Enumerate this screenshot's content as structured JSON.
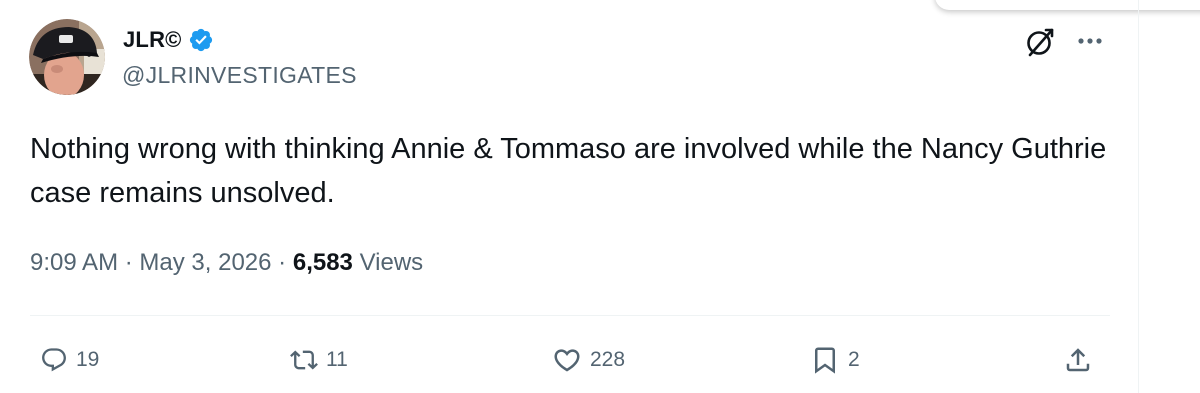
{
  "tweet": {
    "author": {
      "display_name": "JLR©",
      "handle": "@JLRINVESTIGATES",
      "verified": true
    },
    "text": "Nothing wrong with thinking Annie & Tommaso are involved while the Nancy Guthrie case remains unsolved.",
    "time": "9:09 AM",
    "separator": "·",
    "date": "May 3, 2026",
    "views_count": "6,583",
    "views_label": "Views"
  },
  "actions": {
    "replies": "19",
    "reposts": "11",
    "likes": "228",
    "bookmarks": "2"
  },
  "colors": {
    "text_primary": "#0f1419",
    "text_secondary": "#536471",
    "verified_blue": "#1d9bf0",
    "divider": "#eff3f4"
  },
  "icons": {
    "verified": "verified-badge-icon",
    "grok": "grok-icon",
    "more": "more-dots-icon",
    "reply": "reply-bubble-icon",
    "repost": "repost-arrows-icon",
    "like": "heart-icon",
    "bookmark": "bookmark-icon",
    "share": "share-upload-icon"
  }
}
